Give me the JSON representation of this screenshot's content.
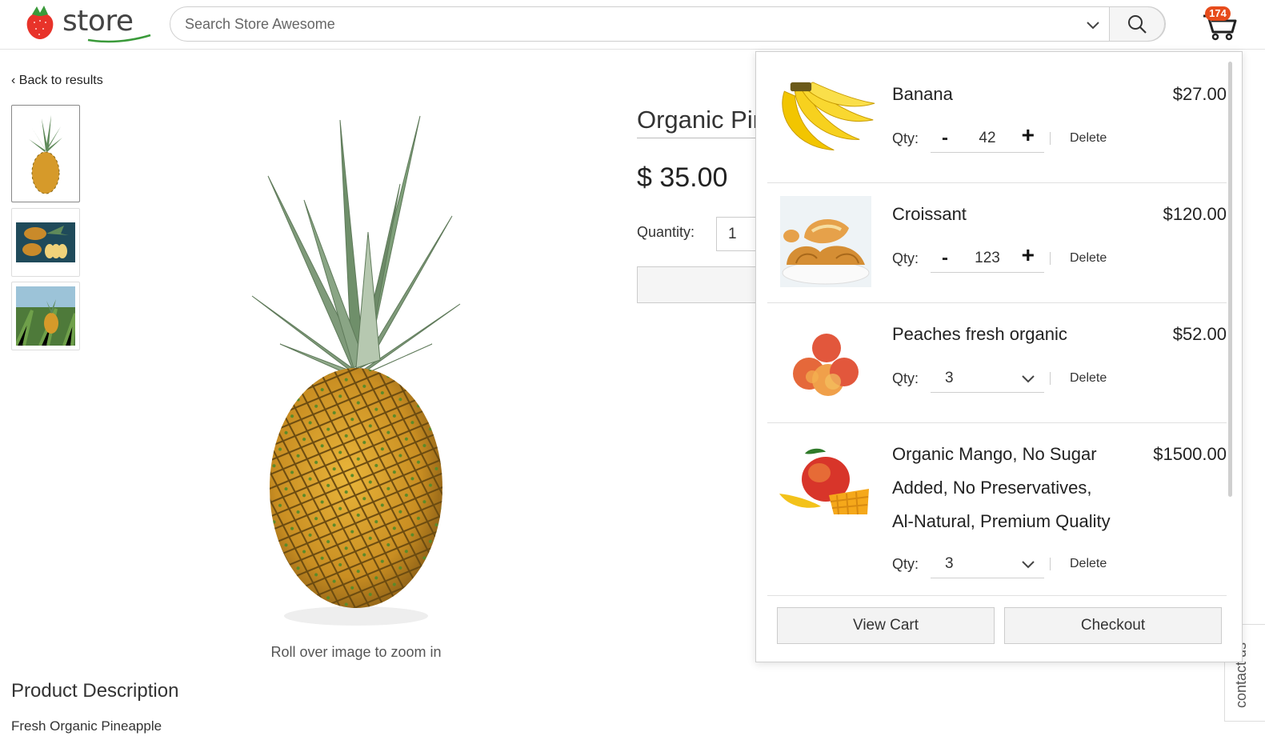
{
  "header": {
    "logo_text": "store",
    "search_placeholder": "Search Store Awesome",
    "cart_count": "174"
  },
  "page": {
    "back_link": "‹ Back to results",
    "zoom_hint": "Roll over image to zoom in",
    "description_heading": "Product Description",
    "description_text": "Fresh Organic Pineapple"
  },
  "product": {
    "title": "Organic Pineapple",
    "price": "$ 35.00",
    "quantity_label": "Quantity:",
    "quantity_value": "1"
  },
  "cart": {
    "items": [
      {
        "name": "Banana",
        "price": "$27.00",
        "qty_label": "Qty:",
        "qty": "42",
        "control": "stepper",
        "minus": "-",
        "plus": "+",
        "delete": "Delete"
      },
      {
        "name": "Croissant",
        "price": "$120.00",
        "qty_label": "Qty:",
        "qty": "123",
        "control": "stepper",
        "minus": "-",
        "plus": "+",
        "delete": "Delete"
      },
      {
        "name": "Peaches fresh organic",
        "price": "$52.00",
        "qty_label": "Qty:",
        "qty": "3",
        "control": "select",
        "delete": "Delete"
      },
      {
        "name_lines": [
          "Organic Mango, No Sugar",
          "Added, No Preservatives,",
          "Al-Natural, Premium Quality"
        ],
        "price": "$1500.00",
        "qty_label": "Qty:",
        "qty": "3",
        "control": "select",
        "delete": "Delete"
      }
    ],
    "view_cart": "View Cart",
    "checkout": "Checkout"
  },
  "contact_tab": "contact us",
  "colors": {
    "badge": "#e74c1c",
    "logo_red": "#e8332a",
    "logo_green": "#3a9a3a"
  },
  "icons": [
    "strawberry-logo-icon",
    "chevron-down-icon",
    "search-icon",
    "cart-icon"
  ]
}
